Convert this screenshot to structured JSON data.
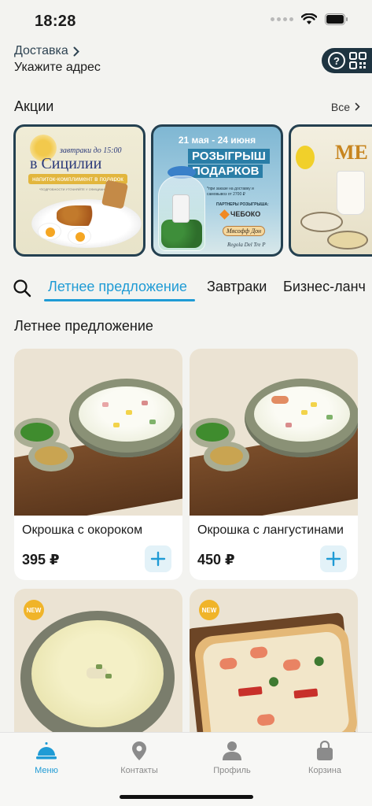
{
  "status_bar": {
    "time": "18:28"
  },
  "header": {
    "delivery_label": "Доставка",
    "address_prompt": "Укажите адрес",
    "help_symbol": "?"
  },
  "promotions": {
    "title": "Акции",
    "all_label": "Все",
    "banners": [
      {
        "line1": "завтраки до 15:00",
        "line2": "в Сицилии",
        "line3": "напиток-комплимент в подарок",
        "line4": "*ПОДРОБНОСТИ УТОЧНЯЙТЕ У ОФИЦИАНТОВ"
      },
      {
        "date": "21 мая - 24 июня",
        "title_line1": "РОЗЫГРЫШ",
        "title_line2": "ПОДАРКОВ",
        "condition": "*при заказе на доставку и самовывоз от 2700 ₽",
        "partners": "ПАРТНЕРЫ РОЗЫГРЫША:",
        "partner1": "ЧЕБОКО",
        "partner2": "Мясофф Дон",
        "partner3": "Regola Del Tre P"
      },
      {
        "title": "МЕ"
      }
    ]
  },
  "categories": {
    "tabs": [
      "Летнее предложение",
      "Завтраки",
      "Бизнес-ланч"
    ],
    "active_index": 0
  },
  "section": {
    "title": "Летнее предложение"
  },
  "products": [
    {
      "name": "Окрошка с окороком",
      "price": "395 ₽",
      "badge": ""
    },
    {
      "name": "Окрошка с лангустинами",
      "price": "450 ₽",
      "badge": ""
    },
    {
      "name": "",
      "price": "",
      "badge": "NEW"
    },
    {
      "name": "",
      "price": "",
      "badge": "NEW"
    }
  ],
  "tab_bar": {
    "items": [
      {
        "label": "Меню",
        "icon": "bell-icon",
        "active": true
      },
      {
        "label": "Контакты",
        "icon": "location-pin-icon",
        "active": false
      },
      {
        "label": "Профиль",
        "icon": "person-icon",
        "active": false
      },
      {
        "label": "Корзина",
        "icon": "bag-icon",
        "active": false
      }
    ]
  },
  "colors": {
    "accent": "#1f9bd5",
    "dark_brand": "#1e3441",
    "background": "#f3f3f0"
  }
}
